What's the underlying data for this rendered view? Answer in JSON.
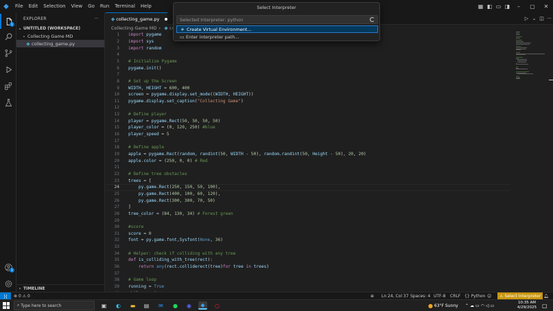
{
  "menu": [
    "File",
    "Edit",
    "Selection",
    "View",
    "Go",
    "Run",
    "Terminal",
    "Help"
  ],
  "explorer": {
    "title": "EXPLORER",
    "workspace": "UNTITLED (WORKSPACE)",
    "folder": "Collecting Game MD",
    "file": "collecting_game.py",
    "timeline": "TIMELINE"
  },
  "tab": {
    "label": "collecting_game.py"
  },
  "breadcrumb": {
    "folder": "Collecting Game MD",
    "file": "colle"
  },
  "quickpick": {
    "title": "Select Interpreter",
    "placeholder": "Selected Interpreter: python",
    "items": [
      "Create Virtual Environment...",
      "Enter interpreter path..."
    ]
  },
  "code": [
    {
      "n": "1",
      "t": "import pygame"
    },
    {
      "n": "2",
      "t": "import sys"
    },
    {
      "n": "3",
      "t": "import random"
    },
    {
      "n": "4",
      "t": ""
    },
    {
      "n": "5",
      "t": "# Initialize Pygame"
    },
    {
      "n": "6",
      "t": "pygame.init()"
    },
    {
      "n": "7",
      "t": ""
    },
    {
      "n": "8",
      "t": "# Set up the Screen"
    },
    {
      "n": "9",
      "t": "WIDTH, HEIGHT = 600, 400"
    },
    {
      "n": "10",
      "t": "screen = pygame.display.set_mode((WIDTH, HEIGHT))"
    },
    {
      "n": "11",
      "t": "pygame.display.set_caption(\"Collecting Game\")"
    },
    {
      "n": "12",
      "t": ""
    },
    {
      "n": "13",
      "t": "# Define player"
    },
    {
      "n": "14",
      "t": "player = pygame.Rect(50, 50, 50, 50)"
    },
    {
      "n": "15",
      "t": "player_color = (0, 120, 250) #blue"
    },
    {
      "n": "16",
      "t": "player_speed = 5"
    },
    {
      "n": "17",
      "t": ""
    },
    {
      "n": "18",
      "t": "# Define apple"
    },
    {
      "n": "19",
      "t": "apple = pygame.Rect(random, randint(50, WIDTH - 50), random.randint(50, Height - 50), 20, 20)"
    },
    {
      "n": "20",
      "t": "apple.color = (250, 0, 0) # Red"
    },
    {
      "n": "21",
      "t": ""
    },
    {
      "n": "22",
      "t": "# Define tree obstacles"
    },
    {
      "n": "23",
      "t": "trees = ["
    },
    {
      "n": "24",
      "t": "    py.game.Rect(250, 150, 50, 100),"
    },
    {
      "n": "25",
      "t": "    py.game.Rect(400, 100, 60, 120),"
    },
    {
      "n": "26",
      "t": "    py.game.Rect(300, 300, 70, 50)"
    },
    {
      "n": "27",
      "t": "]"
    },
    {
      "n": "28",
      "t": "tree_color = (84, 130, 34) # Forest green"
    },
    {
      "n": "29",
      "t": ""
    },
    {
      "n": "30",
      "t": "#score"
    },
    {
      "n": "31",
      "t": "score = 0"
    },
    {
      "n": "32",
      "t": "font = py.game.font,Sysfont(None, 36)"
    },
    {
      "n": "33",
      "t": ""
    },
    {
      "n": "34",
      "t": "# Helper: check if colliding with any tree"
    },
    {
      "n": "35",
      "t": "def is_colliding_with_tree(rect):"
    },
    {
      "n": "36",
      "t": "    return any(rect.colliderect(tree)for tree in trees)"
    },
    {
      "n": "37",
      "t": ""
    },
    {
      "n": "38",
      "t": "# Game loop"
    },
    {
      "n": "39",
      "t": "running = True"
    },
    {
      "n": "40",
      "t": "while running:"
    }
  ],
  "status": {
    "errors": "0",
    "warnings": "0",
    "position": "Ln 24, Col 37",
    "spaces": "Spaces: 4",
    "encoding": "UTF-8",
    "eol": "CRLF",
    "language": "Python",
    "interpreter": "Select Interpreter"
  },
  "taskbar": {
    "search_placeholder": "Type here to search",
    "weather": "63°F  Sunny",
    "time": "10:35 AM",
    "date": "4/29/2025"
  },
  "colors": {
    "accent": "#0078d4",
    "warning": "#c8950c",
    "comment": "#6a9955",
    "keyword": "#c586c0",
    "string": "#ce9178",
    "number": "#b5cea8"
  }
}
